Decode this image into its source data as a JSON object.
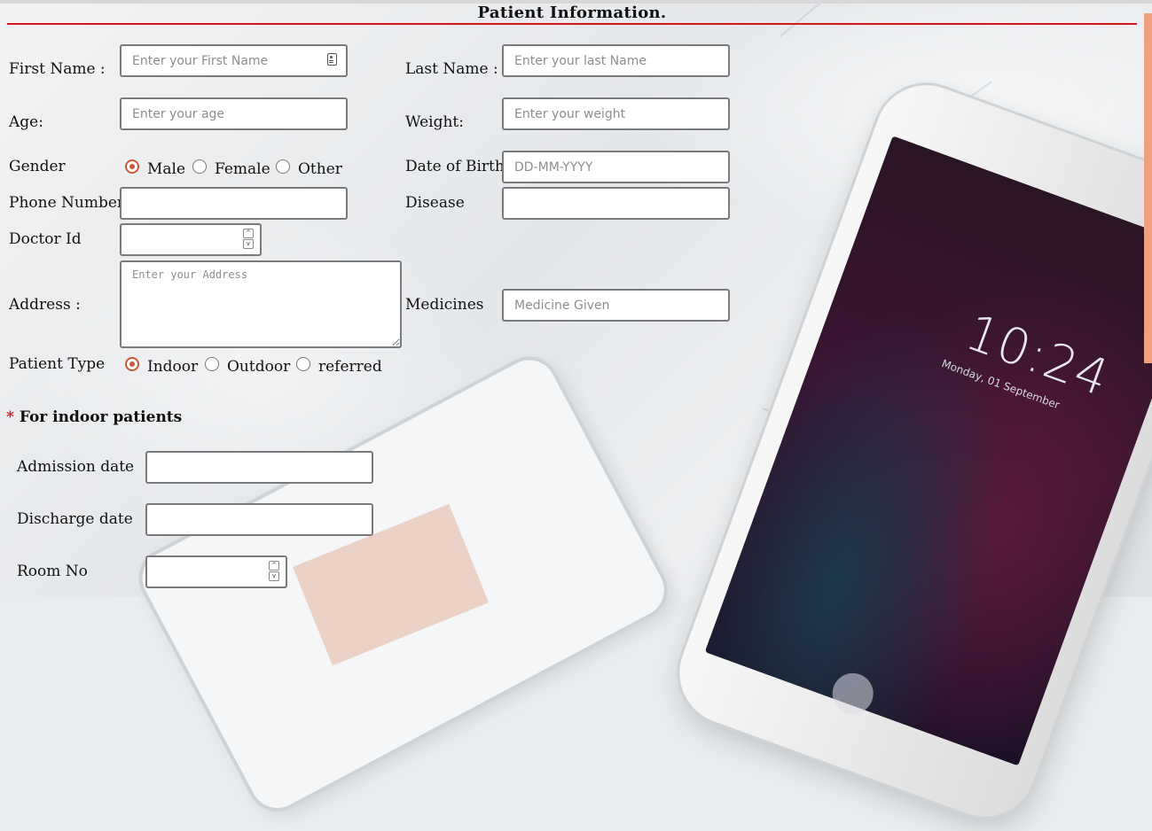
{
  "page": {
    "title": "Patient Information."
  },
  "fields": {
    "first_name": {
      "label": "First Name :",
      "placeholder": "Enter your First Name"
    },
    "last_name": {
      "label": "Last Name :",
      "placeholder": "Enter your last Name"
    },
    "age": {
      "label": "Age:",
      "placeholder": "Enter your age"
    },
    "weight": {
      "label": "Weight:",
      "placeholder": "Enter your weight"
    },
    "gender": {
      "label": "Gender",
      "options": [
        "Male",
        "Female",
        "Other"
      ],
      "selected": "Male"
    },
    "dob": {
      "label": "Date of Birth",
      "placeholder": "DD-MM-YYYY"
    },
    "phone": {
      "label": "Phone Number",
      "placeholder": ""
    },
    "disease": {
      "label": "Disease",
      "placeholder": ""
    },
    "doctor_id": {
      "label": "Doctor Id",
      "placeholder": ""
    },
    "address": {
      "label": "Address :",
      "placeholder": "Enter your Address"
    },
    "medicines": {
      "label": "Medicines",
      "placeholder": "Medicine Given"
    },
    "patient_type": {
      "label": "Patient Type",
      "options": [
        "Indoor",
        "Outdoor",
        "referred"
      ],
      "selected": "Indoor"
    }
  },
  "indoor_section": {
    "marker": "*",
    "heading": "For indoor patients",
    "admission_date": {
      "label": "Admission date",
      "placeholder": ""
    },
    "discharge_date": {
      "label": "Discharge date",
      "placeholder": ""
    },
    "room_no": {
      "label": "Room No",
      "placeholder": ""
    }
  },
  "background": {
    "phone_time": "10:24",
    "phone_date": "Monday, 01 September"
  },
  "colors": {
    "accent": "#c75a36",
    "rule": "#d21818",
    "scrollbar": "#f0a07e"
  }
}
